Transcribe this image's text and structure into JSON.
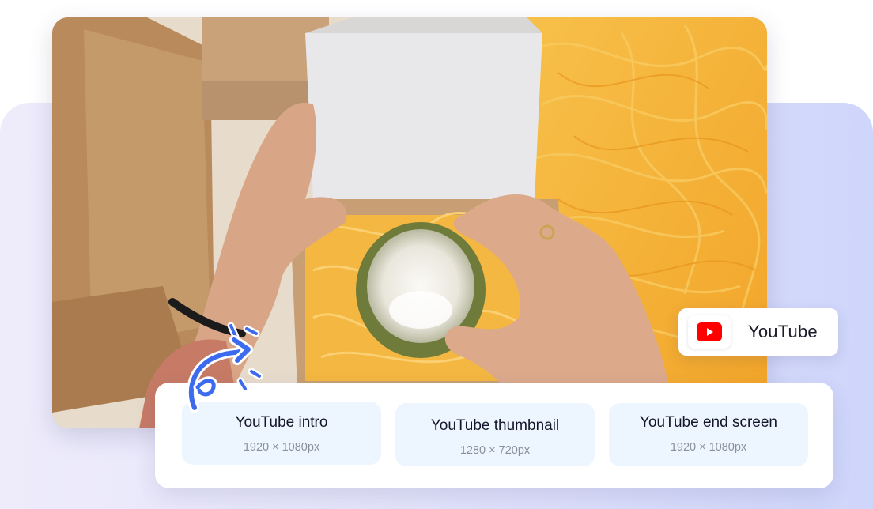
{
  "platform_badge": {
    "label": "YouTube",
    "icon": "youtube-play-icon",
    "icon_color": "#ff0000"
  },
  "photo": {
    "icon": "unboxing-photo"
  },
  "templates": [
    {
      "title": "YouTube intro",
      "size": "1920 × 1080px"
    },
    {
      "title": "YouTube thumbnail",
      "size": "1280 × 720px"
    },
    {
      "title": "YouTube end screen",
      "size": "1920 × 1080px"
    }
  ],
  "colors": {
    "accent": "#3d6bf0",
    "card_bg": "#edf6ff",
    "panel_bg_start": "#eeecfb",
    "panel_bg_end": "#cfd6fb"
  }
}
